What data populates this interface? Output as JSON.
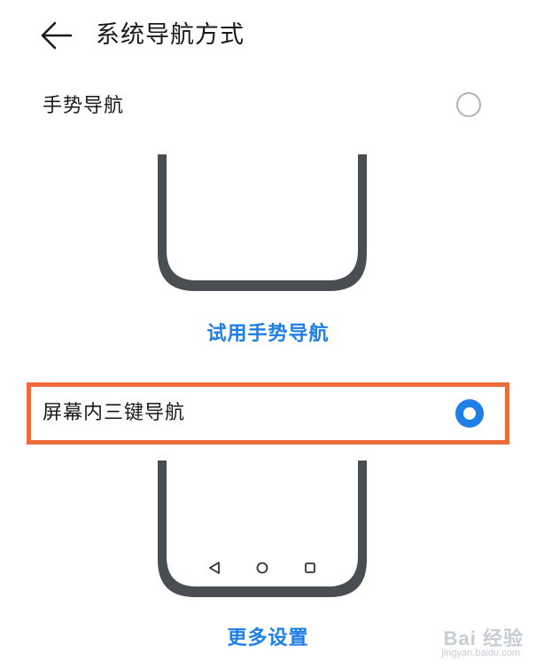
{
  "header": {
    "title": "系统导航方式",
    "back_icon": "arrow-left-icon"
  },
  "options": [
    {
      "label": "手势导航",
      "selected": false,
      "link_label": "试用手势导航"
    },
    {
      "label": "屏幕内三键导航",
      "selected": true,
      "link_label": "更多设置"
    }
  ],
  "nav_buttons": [
    "back-triangle-icon",
    "home-circle-icon",
    "recents-square-icon"
  ],
  "watermark": {
    "main": "Bai 经验",
    "sub": "jingyan.baidu.com"
  },
  "colors": {
    "accent": "#1e7fe6",
    "highlight": "#ef6c3a",
    "phone_frame": "#4a4d52"
  }
}
